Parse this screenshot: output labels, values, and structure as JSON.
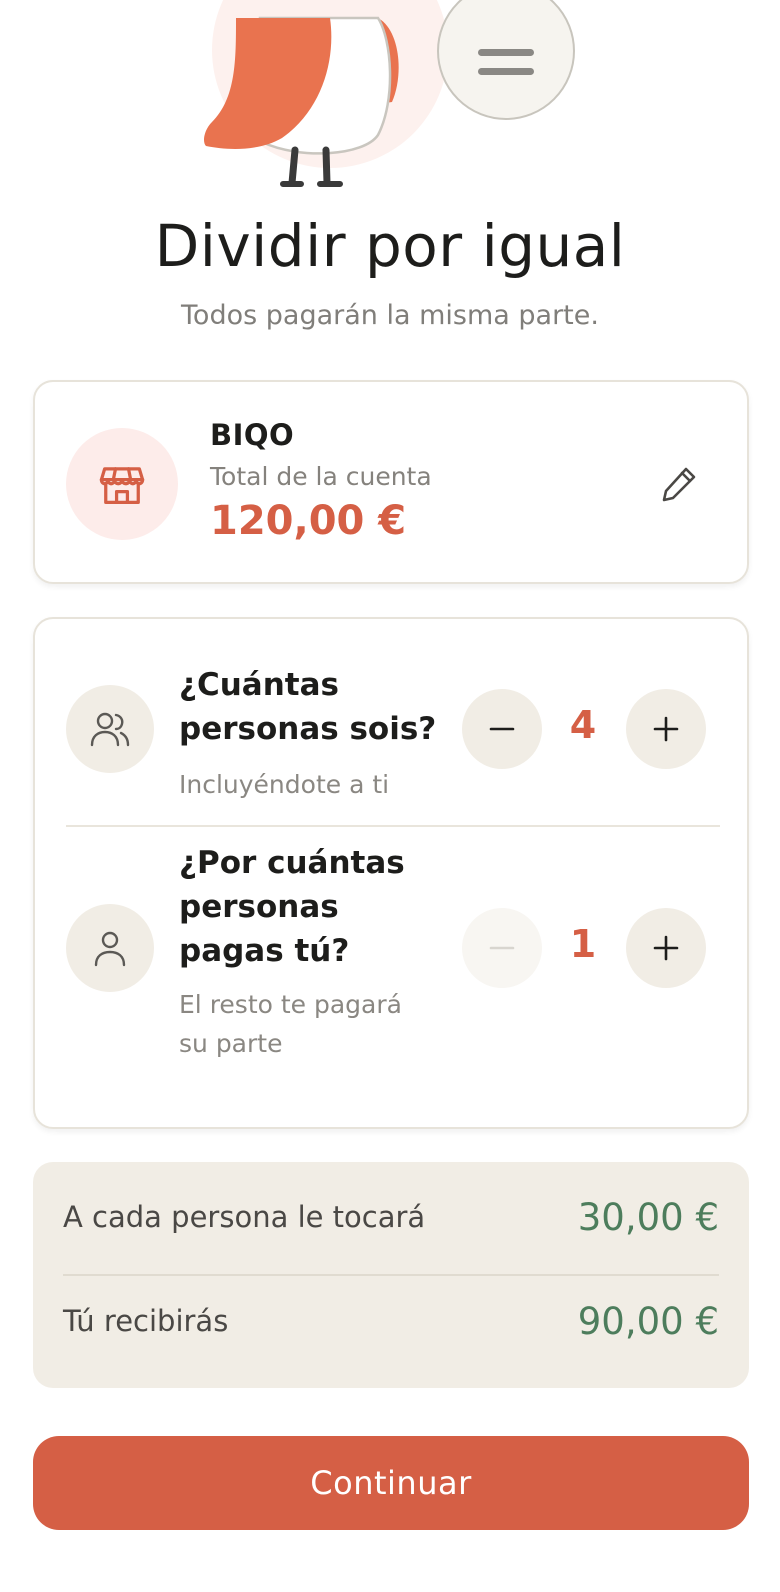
{
  "header": {
    "title": "Dividir por igual",
    "subtitle": "Todos pagarán la misma parte."
  },
  "bill": {
    "name": "BIQO",
    "label": "Total de la cuenta",
    "amount": "120,00 €"
  },
  "people": {
    "question": "¿Cuántas personas sois?",
    "hint": "Incluyéndote a ti",
    "value": "4"
  },
  "paying_for": {
    "question": "¿Por cuántas personas pagas tú?",
    "hint": "El resto te pagará su parte",
    "value": "1"
  },
  "results": {
    "per_person_label": "A cada persona le tocará",
    "per_person_value": "30,00 €",
    "receive_label": "Tú recibirás",
    "receive_value": "90,00 €"
  },
  "cta": {
    "label": "Continuar"
  },
  "icons": {
    "menu": "menu-icon",
    "store": "store-icon",
    "edit": "pencil-icon",
    "group": "users-icon",
    "single": "user-icon",
    "minus": "minus-icon",
    "plus": "plus-icon"
  },
  "colors": {
    "accent": "#d55f45",
    "success": "#4d7d5c",
    "surface": "#f1ede5"
  }
}
